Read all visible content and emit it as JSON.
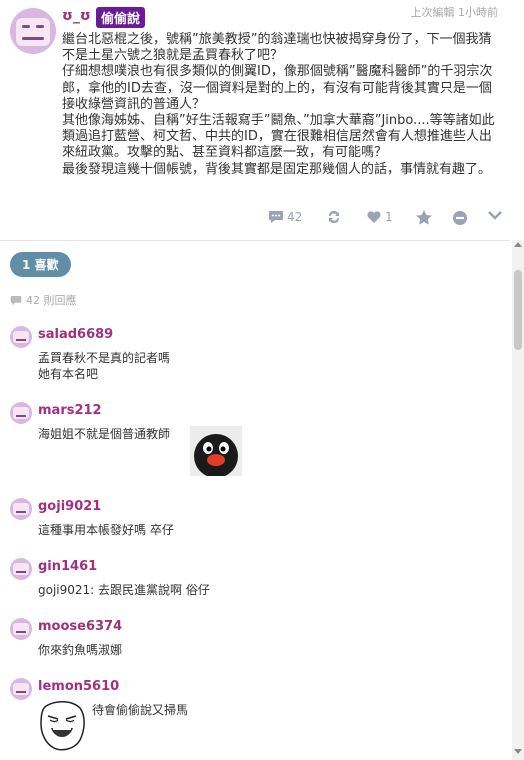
{
  "post": {
    "author": "ʊ_ʊ",
    "badge": "偷偷說",
    "edited": "上次編輯 1小時前",
    "lines": [
      "繼台北惡棍之後，號稱”旅美教授”的翁達瑞也快被揭穿身份了，下一個我猜不是土星六號之狼就是孟買春秋了吧？",
      "仔細想想噗浪也有很多類似的側翼ID，像那個號稱”醫魔科醫師”的千羽宗次郎，拿他的ID去查，沒一個資料是對的上的，有沒有可能背後其實只是一個接收綠營資訊的普通人？",
      "其他像海姊姊、自稱”好生活報寫手”鬭魚、”加拿大華裔”Jinbo....等等諸如此類過追打藍營、柯文哲、中共的ID，實在很難相信居然會有人想推進些人出來紐政黨。攻擊的點、甚至資料都這麼一致，有可能嗎？",
      "最後發現這幾十個帳號，背後其實都是固定那幾個人的話，事情就有趣了。"
    ],
    "actions": {
      "comments": "42",
      "likes": "1"
    }
  },
  "likes_pill": "1 喜歡",
  "reply_count": "42 則回應",
  "comments": [
    {
      "name": "salad6689",
      "text": "孟買春秋不是真的記者嗎\n她有本名吧"
    },
    {
      "name": "mars212",
      "text": "海姐姐不就是個普通教師"
    },
    {
      "name": "goji9021",
      "text": "這種事用本帳發好嗎 卒仔"
    },
    {
      "name": "gin1461",
      "text": "goji9021: 去跟民進黨說啊 俗仔"
    },
    {
      "name": "moose6374",
      "text": "你來釣魚嗎淑娜"
    },
    {
      "name": "lemon5610",
      "text": "待會偷偷說又掃馬"
    }
  ],
  "colors": {
    "accent": "#a0317f",
    "badge": "#6a1b9a",
    "pill": "#5f8ea6",
    "muted": "#9aa3b5"
  }
}
